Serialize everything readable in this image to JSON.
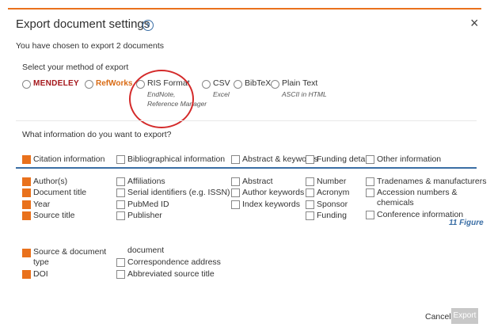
{
  "dialog": {
    "title": "Export document settings",
    "help_icon": "question-circle-icon",
    "close_label": "×",
    "subtitle": "You have chosen to export 2 documents"
  },
  "method": {
    "heading": "Select your method of export",
    "options": [
      {
        "label": "MENDELEY",
        "kind": "logo"
      },
      {
        "label": "RefWorks",
        "kind": "logo"
      },
      {
        "label": "RIS Format",
        "sub1": "EndNote,",
        "sub2": "Reference Manager"
      },
      {
        "label": "CSV",
        "sub1": "Excel"
      },
      {
        "label": "BibTeX"
      },
      {
        "label": "Plain Text",
        "sub1": "ASCII in HTML"
      }
    ]
  },
  "info": {
    "heading": "What information do you want to export?",
    "headers": [
      {
        "label": "Citation information",
        "checked": true
      },
      {
        "label": "Bibliographical information",
        "checked": false
      },
      {
        "label": "Abstract & keywords",
        "checked": false
      },
      {
        "label": "Funding details",
        "checked": false
      },
      {
        "label": "Other information",
        "checked": false
      }
    ],
    "citation": [
      "Author(s)",
      "Document title",
      "Year",
      "Source title"
    ],
    "citation_lower": [
      "Source & document",
      "type",
      "DOI"
    ],
    "bibliographical": [
      "Affiliations",
      "Serial identifiers (e.g. ISSN)",
      "PubMed ID",
      "Publisher"
    ],
    "bibliographical_lower": [
      "document",
      "Correspondence address",
      "Abbreviated source title"
    ],
    "abstract": [
      "Abstract",
      "Author keywords",
      "Index keywords"
    ],
    "funding": [
      "Number",
      "Acronym",
      "Sponsor",
      "Funding"
    ],
    "other": [
      "Tradenames & manufacturers",
      "Accession numbers &",
      "chemicals",
      "Conference information"
    ]
  },
  "figure_label": "11 Figure",
  "footer": {
    "cancel_label": "Cancel",
    "export_label": "Export"
  },
  "colors": {
    "accent": "#e9711c",
    "link": "#3a6ea5",
    "highlight_circle": "#d42a2a"
  }
}
